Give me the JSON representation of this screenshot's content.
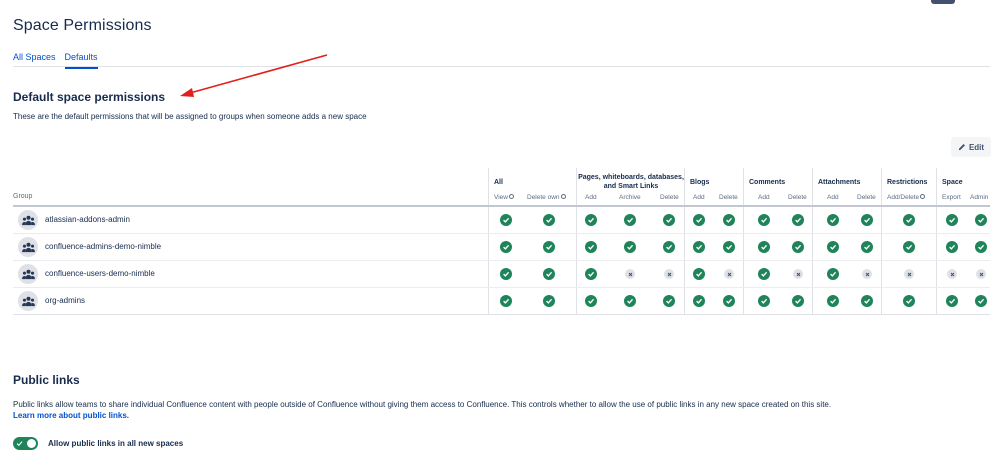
{
  "page": {
    "title": "Space Permissions",
    "tabs": [
      {
        "label": "All Spaces",
        "active": false
      },
      {
        "label": "Defaults",
        "active": true
      }
    ]
  },
  "defaults": {
    "title": "Default space permissions",
    "description": "These are the default permissions that will be assigned to groups when someone adds a new space",
    "edit_label": "Edit"
  },
  "table": {
    "group_label": "Group",
    "groups": [
      {
        "label": "All"
      },
      {
        "label": "Pages, whiteboards, databases, and Smart Links"
      },
      {
        "label": "Blogs"
      },
      {
        "label": "Comments"
      },
      {
        "label": "Attachments"
      },
      {
        "label": "Restrictions"
      },
      {
        "label": "Space"
      }
    ],
    "columns": [
      "View",
      "Delete own",
      "Add",
      "Archive",
      "Delete",
      "Add",
      "Delete",
      "Add",
      "Delete",
      "Add",
      "Delete",
      "Add/Delete",
      "Export",
      "Admin"
    ],
    "rows": [
      {
        "name": "atlassian-addons-admin",
        "perms": [
          1,
          1,
          1,
          1,
          1,
          1,
          1,
          1,
          1,
          1,
          1,
          1,
          1,
          1
        ]
      },
      {
        "name": "confluence-admins-demo-nimble",
        "perms": [
          1,
          1,
          1,
          1,
          1,
          1,
          1,
          1,
          1,
          1,
          1,
          1,
          1,
          1
        ]
      },
      {
        "name": "confluence-users-demo-nimble",
        "perms": [
          1,
          1,
          1,
          0,
          0,
          1,
          0,
          1,
          0,
          1,
          0,
          0,
          0,
          0
        ]
      },
      {
        "name": "org-admins",
        "perms": [
          1,
          1,
          1,
          1,
          1,
          1,
          1,
          1,
          1,
          1,
          1,
          1,
          1,
          1
        ]
      }
    ]
  },
  "public_links": {
    "title": "Public links",
    "description": "Public links allow teams to share individual Confluence content with people outside of Confluence without giving them access to Confluence. This controls whether to allow the use of public links in any new space created on this site.",
    "learn_more": "Learn more about public links.",
    "toggle_label": "Allow public links in all new spaces",
    "toggle_on": true
  },
  "colors": {
    "accent": "#0052cc",
    "granted": "#1f845a",
    "denied": "#dfe1e6",
    "annotation_arrow": "#e0201b"
  }
}
